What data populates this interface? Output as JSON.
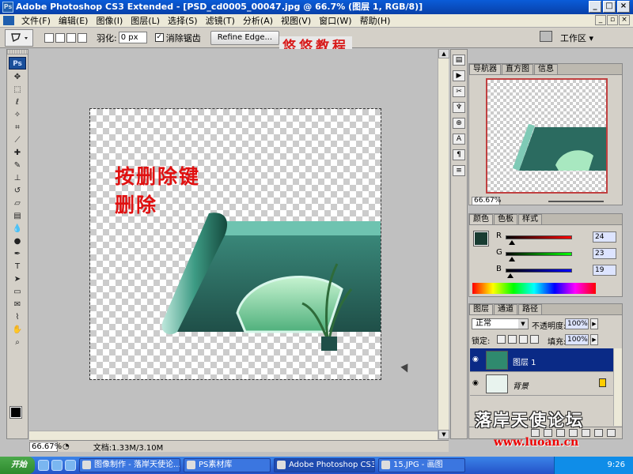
{
  "window": {
    "title": "Adobe Photoshop CS3 Extended - [PSD_cd0005_00047.jpg @ 66.7% (图层 1, RGB/8)]",
    "ps_icon": "Ps"
  },
  "menu": [
    "文件(F)",
    "编辑(E)",
    "图像(I)",
    "图层(L)",
    "选择(S)",
    "滤镜(T)",
    "分析(A)",
    "视图(V)",
    "窗口(W)",
    "帮助(H)"
  ],
  "options": {
    "feather_label": "羽化:",
    "feather_value": "0 px",
    "antialias_label": "消除锯齿",
    "refine_label": "Refine Edge...",
    "workspace_label": "工作区 ▾"
  },
  "stamp_text": "悠悠教程",
  "canvas": {
    "annotation_line1": "按删除键",
    "annotation_line2": "删除"
  },
  "status": {
    "zoom": "66.67%",
    "doc_info": "文档:1.33M/3.10M"
  },
  "navigator": {
    "tabs": [
      "导航器",
      "直方图",
      "信息"
    ],
    "zoom": "66.67%"
  },
  "color_panel": {
    "tabs": [
      "颜色",
      "色板",
      "样式"
    ],
    "r_label": "R",
    "g_label": "G",
    "b_label": "B",
    "r": "24",
    "g": "23",
    "b": "19",
    "r_level": 0.09,
    "g_level": 0.09,
    "b_level": 0.07
  },
  "layers_panel": {
    "tabs": [
      "图层",
      "通道",
      "路径"
    ],
    "blend_mode": "正常",
    "opacity_label": "不透明度:",
    "opacity": "100%",
    "lock_label": "锁定:",
    "fill_label": "填充:",
    "fill": "100%",
    "layers": [
      {
        "name": "图层 1",
        "selected": true
      },
      {
        "name": "背景",
        "selected": false
      }
    ]
  },
  "watermark": {
    "title": "落岸天使论坛",
    "url": "www.luoan.cn"
  },
  "taskbar": {
    "start": "开始",
    "tasks": [
      "图像制作 - 落岸天使论...",
      "PS素材库",
      "Adobe Photoshop CS3 E...",
      "15.JPG - 画图"
    ],
    "clock": "9:26"
  },
  "tools": [
    "move-tool",
    "marquee-tool",
    "lasso-tool",
    "magic-wand-tool",
    "crop-tool",
    "slice-tool",
    "healing-brush-tool",
    "brush-tool",
    "clone-stamp-tool",
    "history-brush-tool",
    "eraser-tool",
    "gradient-tool",
    "blur-tool",
    "dodge-tool",
    "pen-tool",
    "type-tool",
    "path-selection-tool",
    "shape-tool",
    "notes-tool",
    "eyedropper-tool",
    "hand-tool",
    "zoom-tool"
  ],
  "colors": {
    "titlebar": "#0840a8",
    "annotation": "#e01010",
    "stamp": "#d81a1a",
    "layer_selected": "#0a2a86",
    "fg_color": "#183c32"
  }
}
